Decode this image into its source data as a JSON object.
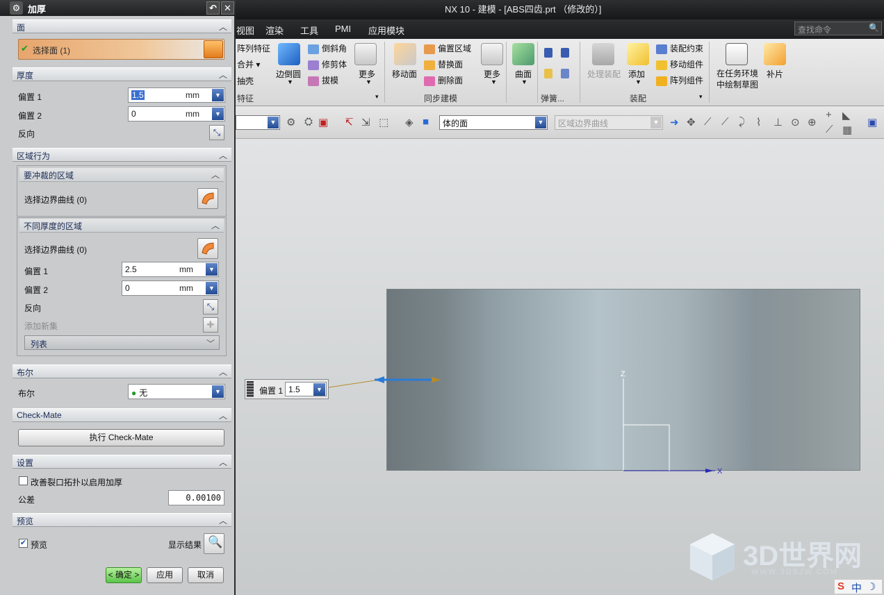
{
  "app": {
    "window_title": "NX 10 - 建模 - [ABS四齿.prt （修改的）]",
    "menu": [
      "视图",
      "渲染",
      "工具",
      "PMI",
      "应用模块"
    ],
    "search_placeholder": "查找命令"
  },
  "ribbon": {
    "feature": {
      "array": "阵列特征",
      "merge": "合并",
      "shell": "抽壳",
      "edge_blend": "边倒圆",
      "chamfer": "倒斜角",
      "trim_body": "修剪体",
      "draft": "拔模",
      "more": "更多",
      "group": "特征"
    },
    "sync": {
      "move_face": "移动面",
      "offset_region": "偏置区域",
      "replace_face": "替换面",
      "delete_face": "删除面",
      "more": "更多",
      "group": "同步建模"
    },
    "surface": {
      "label": "曲面"
    },
    "spring": {
      "group": "弹簧..."
    },
    "assembly": {
      "process": "处理装配",
      "add": "添加",
      "constraint": "装配约束",
      "move_comp": "移动组件",
      "array_comp": "阵列组件",
      "group": "装配"
    },
    "sketch": {
      "label": "在任务环境中绘制草图",
      "line1": "在任务环境",
      "line2": "中绘制草图"
    },
    "patch": {
      "label": "补片"
    }
  },
  "toolbar2": {
    "face_rule": "体的面",
    "curve_rule": "区域边界曲线"
  },
  "viewport": {
    "float_label": "偏置 1",
    "float_value": "1.5",
    "axis_z": "Z",
    "axis_x": "X",
    "watermark": "3D世界网",
    "watermark_url": "WWW.3DSJW.COM",
    "ime": "中"
  },
  "dialog": {
    "title": "加厚",
    "face_section": "面",
    "select_face": "选择面 (1)",
    "thickness_section": "厚度",
    "offset1_label": "偏置 1",
    "offset1_value": "1.5",
    "offset2_label": "偏置 2",
    "offset2_value": "0",
    "unit": "mm",
    "reverse": "反向",
    "region_section": "区域行为",
    "punch_region": "要冲裁的区域",
    "select_curve": "选择边界曲线 (0)",
    "diff_region": "不同厚度的区域",
    "select_curve2": "选择边界曲线 (0)",
    "r_offset1_label": "偏置 1",
    "r_offset1_value": "2.5",
    "r_offset2_label": "偏置 2",
    "r_offset2_value": "0",
    "r_reverse": "反向",
    "add_set": "添加新集",
    "list": "列表",
    "bool_section": "布尔",
    "bool_label": "布尔",
    "bool_value": "无",
    "checkmate_section": "Check-Mate",
    "checkmate_btn": "执行 Check-Mate",
    "settings_section": "设置",
    "improve_topology": "改善裂口拓扑以启用加厚",
    "improve_checked": false,
    "tolerance_label": "公差",
    "tolerance_value": "0.00100",
    "preview_section": "预览",
    "preview_label": "预览",
    "preview_checked": true,
    "show_result": "显示结果",
    "ok": "< 确定 >",
    "apply": "应用",
    "cancel": "取消"
  }
}
